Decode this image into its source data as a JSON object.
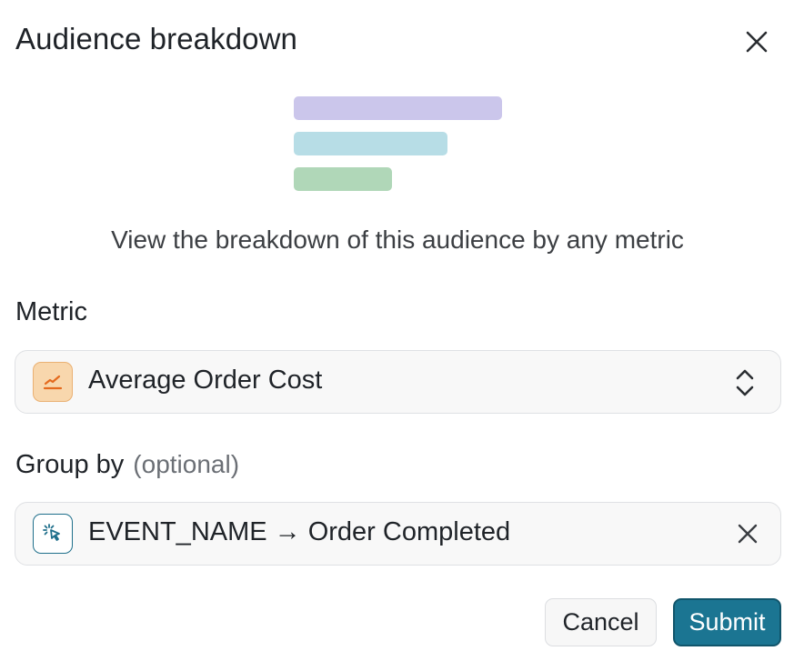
{
  "dialog": {
    "title": "Audience breakdown",
    "close_icon": "close-icon",
    "description": "View the breakdown of this audience by any metric"
  },
  "illustration": {
    "bar_colors": [
      "#cbc6eb",
      "#b7dde6",
      "#b0d7b8"
    ]
  },
  "metric": {
    "label": "Metric",
    "value": "Average Order Cost",
    "icon": "metric-line-chart-icon",
    "icon_color": "#e46a1e",
    "control_icon": "chevron-up-down-icon"
  },
  "group_by": {
    "label": "Group by",
    "optional_hint": "(optional)",
    "value": "EVENT_NAME → Order Completed",
    "icon": "event-click-icon",
    "icon_color": "#1f6f8b",
    "clear_icon": "clear-icon"
  },
  "actions": {
    "cancel_label": "Cancel",
    "submit_label": "Submit",
    "submit_color": "#1b7592"
  }
}
